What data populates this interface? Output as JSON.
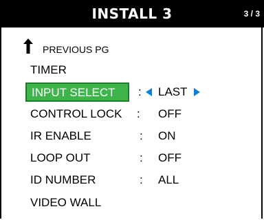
{
  "header": {
    "title": "INSTALL 3",
    "page": "3 / 3"
  },
  "menu": {
    "previous": "PREVIOUS PG",
    "timer": "TIMER",
    "input_select": {
      "label": "INPUT SELECT",
      "colon": ":",
      "value": "LAST"
    },
    "control_lock": {
      "label": "CONTROL LOCK",
      "colon": ":",
      "value": "OFF"
    },
    "ir_enable": {
      "label": "IR ENABLE",
      "colon": ":",
      "value": "ON"
    },
    "loop_out": {
      "label": "LOOP OUT",
      "colon": ":",
      "value": "OFF"
    },
    "id_number": {
      "label": "ID NUMBER",
      "colon": ":",
      "value": "ALL"
    },
    "video_wall": "VIDEO WALL"
  },
  "colors": {
    "header_bg": "#000000",
    "selected_bg": "#3db54a",
    "arrow": "#0a80d8"
  },
  "icons": {
    "previous": "up-arrow-icon",
    "decrease": "left-triangle-icon",
    "increase": "right-triangle-icon"
  }
}
